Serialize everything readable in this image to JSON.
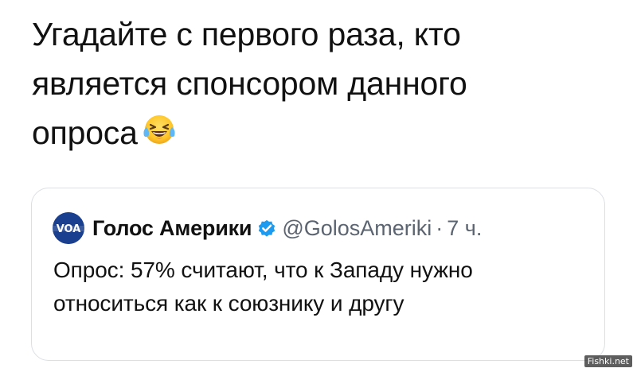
{
  "tweet": {
    "text_lines": [
      "Угадайте с первого раза, кто",
      "является спонсором данного",
      "опроса"
    ],
    "emoji": "face-with-tears-of-joy-icon"
  },
  "quoted_tweet": {
    "avatar_text": "VOA",
    "display_name": "Голос Америки",
    "verified": true,
    "handle": "@GolosAmeriki",
    "separator": "·",
    "time": "7 ч.",
    "text_lines": [
      "Опрос: 57% считают, что к Западу нужно",
      "относиться как к союзнику и другу"
    ]
  },
  "watermark": "Fishki.net",
  "colors": {
    "verified_badge": "#1d9bf0",
    "avatar_bg": "#1a3f8f",
    "secondary_text": "#5b6470",
    "card_border": "#dcdfe3"
  }
}
